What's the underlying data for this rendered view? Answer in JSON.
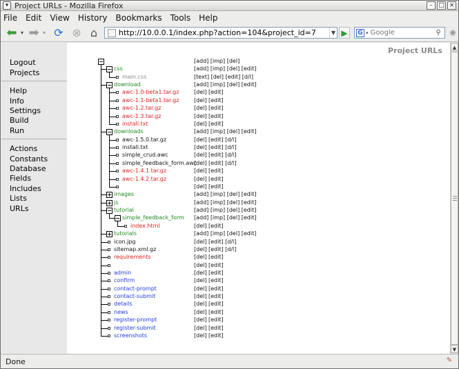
{
  "window": {
    "title": "Project URLs - Mozilla Firefox"
  },
  "menu": [
    "File",
    "Edit",
    "View",
    "History",
    "Bookmarks",
    "Tools",
    "Help"
  ],
  "toolbar": {
    "url": "http://10.0.0.1/index.php?action=104&project_id=7",
    "search_placeholder": "Google"
  },
  "sidebar": {
    "groups": [
      [
        "Logout",
        "Projects"
      ],
      [
        "Help",
        "Info",
        "Settings",
        "Build",
        "Run"
      ],
      [
        "Actions",
        "Constants",
        "Database",
        "Fields",
        "Includes",
        "Lists",
        "URLs"
      ]
    ]
  },
  "page": {
    "title": "Project URLs"
  },
  "tree": [
    {
      "depth": 0,
      "type": "root",
      "label": "",
      "color": "black",
      "actions": "[add] [imp] [del]"
    },
    {
      "depth": 1,
      "type": "folder",
      "label": "css",
      "color": "green",
      "actions": "[add] [imp] [del] [edit]"
    },
    {
      "depth": 2,
      "type": "leaf",
      "label": "main.css",
      "color": "grey",
      "actions": "[text] [del] [edit] [d/l]"
    },
    {
      "depth": 1,
      "type": "folder",
      "label": "download",
      "color": "green",
      "actions": "[add] [imp] [del] [edit]"
    },
    {
      "depth": 2,
      "type": "leaf",
      "label": "awc-1.0-beta1.tar.gz",
      "color": "red",
      "actions": "[del] [edit]"
    },
    {
      "depth": 2,
      "type": "leaf",
      "label": "awc-1.1-beta1.tar.gz",
      "color": "red",
      "actions": "[del] [edit]"
    },
    {
      "depth": 2,
      "type": "leaf",
      "label": "awc-1.2.tar.gz",
      "color": "red",
      "actions": "[del] [edit]"
    },
    {
      "depth": 2,
      "type": "leaf",
      "label": "awc-1.3.tar.gz",
      "color": "red",
      "actions": "[del] [edit]"
    },
    {
      "depth": 2,
      "type": "leaf",
      "label": "install.txt",
      "color": "red",
      "actions": "[del] [edit]"
    },
    {
      "depth": 1,
      "type": "folder",
      "label": "downloads",
      "color": "green",
      "actions": "[add] [imp] [del] [edit]"
    },
    {
      "depth": 2,
      "type": "leaf",
      "label": "awc-1.5.0.tar.gz",
      "color": "black",
      "actions": "[del] [edit] [d/l]"
    },
    {
      "depth": 2,
      "type": "leaf",
      "label": "install.txt",
      "color": "black",
      "actions": "[del] [edit] [d/l]"
    },
    {
      "depth": 2,
      "type": "leaf",
      "label": "simple_crud.awc",
      "color": "black",
      "actions": "[del] [edit] [d/l]"
    },
    {
      "depth": 2,
      "type": "leaf",
      "label": "simple_feedback_form.awc",
      "color": "black",
      "actions": "[del] [edit] [d/l]"
    },
    {
      "depth": 2,
      "type": "leaf",
      "label": "awc-1.4.1.tar.gz",
      "color": "red",
      "actions": "[del] [edit]"
    },
    {
      "depth": 2,
      "type": "leaf",
      "label": "awc-1.4.2.tar.gz",
      "color": "red",
      "actions": "[del] [edit]"
    },
    {
      "depth": 2,
      "type": "leaf",
      "label": "",
      "color": "black",
      "actions": "[del] [edit]"
    },
    {
      "depth": 1,
      "type": "collapsed",
      "label": "images",
      "color": "green",
      "actions": "[add] [imp] [del] [edit]"
    },
    {
      "depth": 1,
      "type": "collapsed",
      "label": "js",
      "color": "green",
      "actions": "[add] [imp] [del] [edit]"
    },
    {
      "depth": 1,
      "type": "folder",
      "label": "tutorial",
      "color": "green",
      "actions": "[add] [imp] [del] [edit]"
    },
    {
      "depth": 2,
      "type": "folder",
      "label": "simple_feedback_form",
      "color": "green",
      "actions": "[add] [imp] [del] [edit]"
    },
    {
      "depth": 3,
      "type": "leaf",
      "label": "index.html",
      "color": "red",
      "actions": "[del] [edit]"
    },
    {
      "depth": 1,
      "type": "collapsed",
      "label": "tutorials",
      "color": "green",
      "actions": "[add] [imp] [del] [edit]"
    },
    {
      "depth": 1,
      "type": "leaf",
      "label": "icon.jpg",
      "color": "black",
      "actions": "[del] [edit] [d/l]"
    },
    {
      "depth": 1,
      "type": "leaf",
      "label": "sitemap.xml.gz",
      "color": "black",
      "actions": "[del] [edit] [d/l]"
    },
    {
      "depth": 1,
      "type": "leaf",
      "label": "requirements",
      "color": "red",
      "actions": "[del] [edit]"
    },
    {
      "depth": 1,
      "type": "leaf",
      "label": "",
      "color": "black",
      "actions": "[del] [edit]"
    },
    {
      "depth": 1,
      "type": "leaf",
      "label": "admin",
      "color": "blue",
      "actions": "[del] [edit]"
    },
    {
      "depth": 1,
      "type": "leaf",
      "label": "confirm",
      "color": "blue",
      "actions": "[del] [edit]"
    },
    {
      "depth": 1,
      "type": "leaf",
      "label": "contact-prompt",
      "color": "blue",
      "actions": "[del] [edit]"
    },
    {
      "depth": 1,
      "type": "leaf",
      "label": "contact-submit",
      "color": "blue",
      "actions": "[del] [edit]"
    },
    {
      "depth": 1,
      "type": "leaf",
      "label": "details",
      "color": "blue",
      "actions": "[del] [edit]"
    },
    {
      "depth": 1,
      "type": "leaf",
      "label": "news",
      "color": "blue",
      "actions": "[del] [edit]"
    },
    {
      "depth": 1,
      "type": "leaf",
      "label": "register-prompt",
      "color": "blue",
      "actions": "[del] [edit]"
    },
    {
      "depth": 1,
      "type": "leaf",
      "label": "register-submit",
      "color": "blue",
      "actions": "[del] [edit]"
    },
    {
      "depth": 1,
      "type": "leaf",
      "label": "screenshots",
      "color": "blue",
      "actions": "[del] [edit]"
    }
  ],
  "status": {
    "text": "Done"
  }
}
